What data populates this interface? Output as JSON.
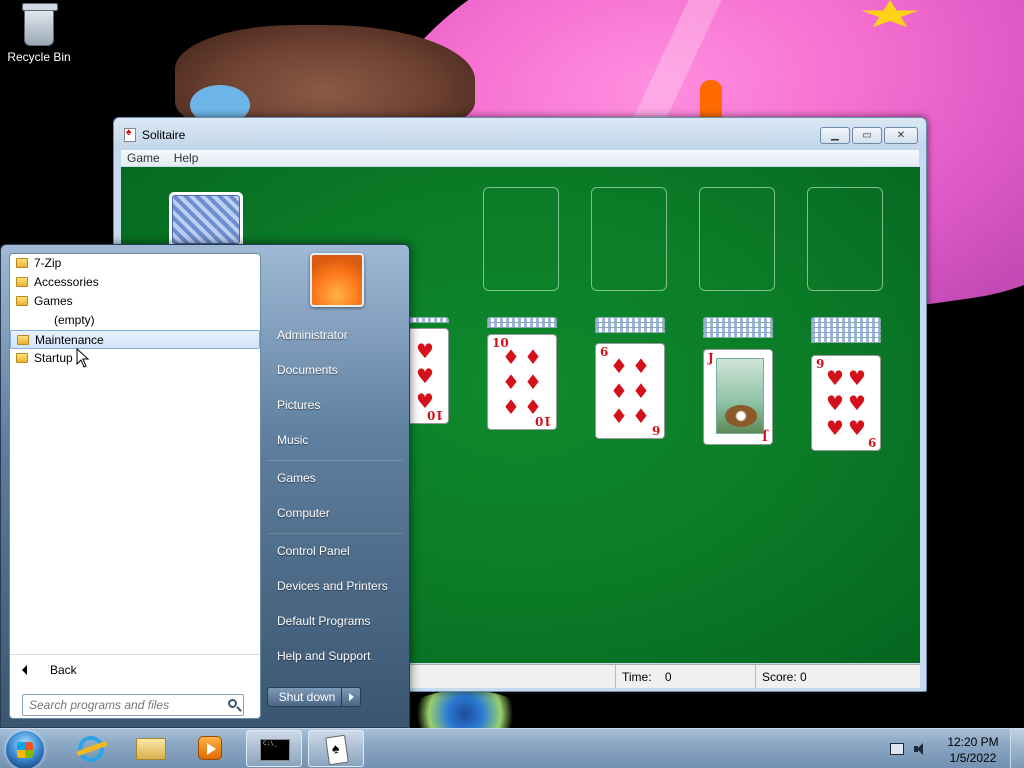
{
  "desktop": {
    "recycle_bin_label": "Recycle Bin"
  },
  "solitaire": {
    "title": "Solitaire",
    "menu": [
      "Game",
      "Help"
    ],
    "status": {
      "time_label": "Time:",
      "time_value": "0",
      "score_label": "Score:",
      "score_value": "0"
    },
    "tableau_visible": [
      {
        "rank": "10",
        "suit": "hearts",
        "symbol": "♥"
      },
      {
        "rank": "10",
        "suit": "diamonds",
        "symbol": "♦"
      },
      {
        "rank": "6",
        "suit": "diamonds",
        "symbol": "♦"
      },
      {
        "rank": "J",
        "suit": "diamonds",
        "symbol": "♦"
      },
      {
        "rank": "9",
        "suit": "hearts",
        "symbol": "♥"
      }
    ],
    "colors": {
      "felt": "#0b7a27",
      "red_suit": "#d4101a"
    }
  },
  "start_menu": {
    "programs": [
      {
        "label": "7-Zip",
        "type": "folder"
      },
      {
        "label": "Accessories",
        "type": "folder"
      },
      {
        "label": "Games",
        "type": "folder"
      },
      {
        "label": "(empty)",
        "type": "sub"
      },
      {
        "label": "Maintenance",
        "type": "folder",
        "selected": true
      },
      {
        "label": "Startup",
        "type": "folder"
      }
    ],
    "back_label": "Back",
    "search_placeholder": "Search programs and files",
    "right_items": [
      "Administrator",
      "Documents",
      "Pictures",
      "Music",
      "Games",
      "Computer",
      "Control Panel",
      "Devices and Printers",
      "Default Programs",
      "Help and Support"
    ],
    "shutdown_label": "Shut down"
  },
  "taskbar": {
    "time": "12:20 PM",
    "date": "1/5/2022",
    "pinned": [
      "internet-explorer-icon",
      "windows-explorer-icon",
      "media-player-icon",
      "command-prompt-icon",
      "solitaire-icon"
    ]
  }
}
